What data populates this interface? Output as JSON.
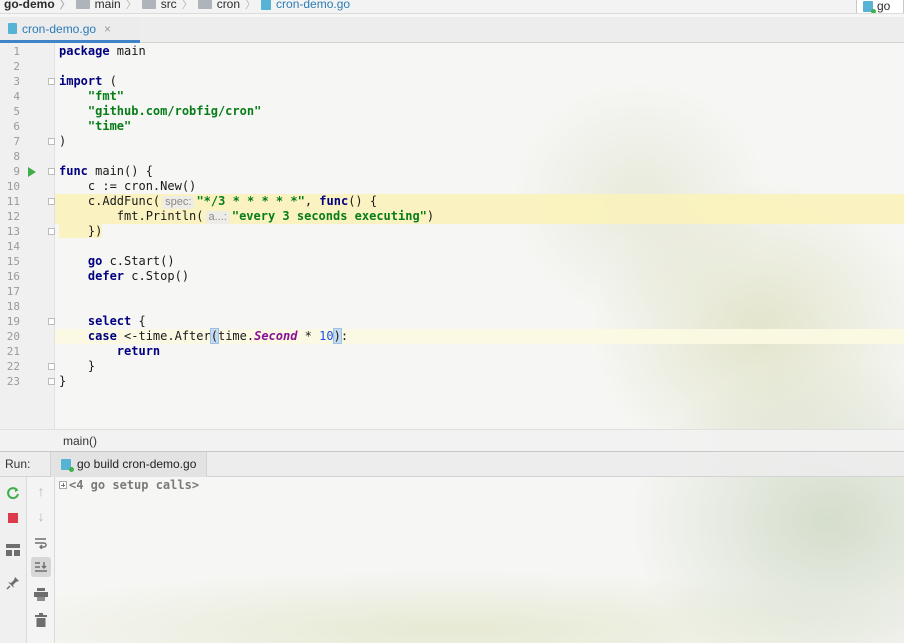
{
  "navbar": {
    "crumbs": [
      "go-demo",
      "main",
      "src",
      "cron",
      "cron-demo.go"
    ],
    "run_config_label": "go"
  },
  "editor_tab": {
    "label": "cron-demo.go",
    "close_glyph": "×"
  },
  "editor": {
    "line_numbers": [
      "1",
      "2",
      "3",
      "4",
      "5",
      "6",
      "7",
      "8",
      "9",
      "10",
      "11",
      "12",
      "13",
      "14",
      "15",
      "16",
      "17",
      "18",
      "19",
      "20",
      "21",
      "22",
      "23"
    ],
    "code": {
      "l1_kw": "package",
      "l1_rest": " main",
      "l3_kw": "import",
      "l3_rest": " (",
      "l4_str": "\"fmt\"",
      "l5_str": "\"github.com/robfig/cron\"",
      "l6_str": "\"time\"",
      "l7": ")",
      "l9_kw": "func",
      "l9_rest": " main() {",
      "l10": "    c := cron.New()",
      "l11_a": "    c.AddFunc(",
      "l11_hint": "spec:",
      "l11_str": "\"*/3 * * * * *\"",
      "l11_b": ", ",
      "l11_kw": "func",
      "l11_c": "() {",
      "l12_a": "        fmt.Println(",
      "l12_hint": "a...:",
      "l12_str": "\"every 3 seconds executing\"",
      "l12_b": ")",
      "l13": "    })",
      "l15_kw": "go",
      "l15_rest": " c.Start()",
      "l16_kw": "defer",
      "l16_rest": " c.Stop()",
      "l19_kw": "select",
      "l19_rest": " {",
      "l20_kw": "case",
      "l20_a": " <-time.After",
      "l20_paren": "(",
      "l20_b": "time.",
      "l20_it": "Second",
      "l20_c": " * ",
      "l20_num": "10",
      "l20_close": ")",
      "l20_d": ":",
      "l21_kw": "return",
      "l22": "    }",
      "l23": "}"
    }
  },
  "editor_breadcrumb": "main()",
  "run_panel": {
    "title": "Run:",
    "tab_label": "go build cron-demo.go",
    "console_text": "<4 go setup calls>"
  },
  "icons": {
    "rerun": "rerun-icon",
    "stop": "stop-icon",
    "layout": "layout-icon",
    "pin": "pin-icon",
    "up": "arrow-up-icon",
    "down": "arrow-down-icon",
    "wrap": "soft-wrap-icon",
    "scroll": "scroll-to-end-icon",
    "print": "print-icon",
    "trash": "trash-icon"
  }
}
